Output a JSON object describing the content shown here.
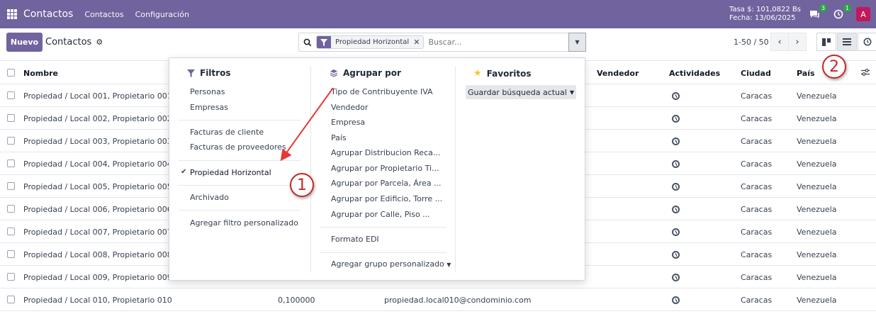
{
  "navbar": {
    "brand": "Contactos",
    "links": [
      "Contactos",
      "Configuración"
    ],
    "rate": "Tasa $: 101,0822 Bs",
    "date": "Fecha: 13/06/2025",
    "messages_count": "3",
    "activities_count": "1",
    "avatar_letter": "A",
    "accent_color": "#71639e"
  },
  "control": {
    "new_button": "Nuevo",
    "breadcrumb": "Contactos",
    "facet_label": "Propiedad Horizontal",
    "search_placeholder": "Buscar...",
    "pager": "1-50 / 50"
  },
  "table": {
    "columns": [
      "Nombre",
      "Vendedor",
      "Actividades",
      "Ciudad",
      "País"
    ],
    "rows": [
      {
        "name": "Propiedad / Local 001, Propietario 001",
        "city": "Caracas",
        "country": "Venezuela"
      },
      {
        "name": "Propiedad / Local 002, Propietario 002",
        "city": "Caracas",
        "country": "Venezuela"
      },
      {
        "name": "Propiedad / Local 003, Propietario 003",
        "city": "Caracas",
        "country": "Venezuela"
      },
      {
        "name": "Propiedad / Local 004, Propietario 004",
        "city": "Caracas",
        "country": "Venezuela"
      },
      {
        "name": "Propiedad / Local 005, Propietario 005",
        "city": "Caracas",
        "country": "Venezuela"
      },
      {
        "name": "Propiedad / Local 006, Propietario 006",
        "city": "Caracas",
        "country": "Venezuela"
      },
      {
        "name": "Propiedad / Local 007, Propietario 007",
        "city": "Caracas",
        "country": "Venezuela"
      },
      {
        "name": "Propiedad / Local 008, Propietario 008",
        "city": "Caracas",
        "country": "Venezuela"
      },
      {
        "name": "Propiedad / Local 009, Propietario 009",
        "city": "Caracas",
        "country": "Venezuela"
      },
      {
        "name": "Propiedad / Local 010, Propietario 010",
        "city": "Caracas",
        "country": "Venezuela",
        "value": "0,100000",
        "email": "propiedad.local010@condominio.com"
      }
    ]
  },
  "dropdown": {
    "filters_title": "Filtros",
    "filters": [
      "Personas",
      "Empresas",
      "Facturas de cliente",
      "Facturas de proveedores",
      "Propiedad Horizontal",
      "Archivado",
      "Agregar filtro personalizado"
    ],
    "group_title": "Agrupar por",
    "groups": [
      "Tipo de Contribuyente IVA",
      "Vendedor",
      "Empresa",
      "País",
      "Agrupar Distribucion Reca...",
      "Agrupar por Propietario Ti...",
      "Agrupar por Parcela, Área ...",
      "Agrupar por Edificio, Torre ...",
      "Agrupar por Calle, Piso ...",
      "Formato EDI",
      "Agregar grupo personalizado"
    ],
    "favorites_title": "Favoritos",
    "save_search": "Guardar búsqueda actual"
  },
  "annotations": [
    "1",
    "2"
  ]
}
